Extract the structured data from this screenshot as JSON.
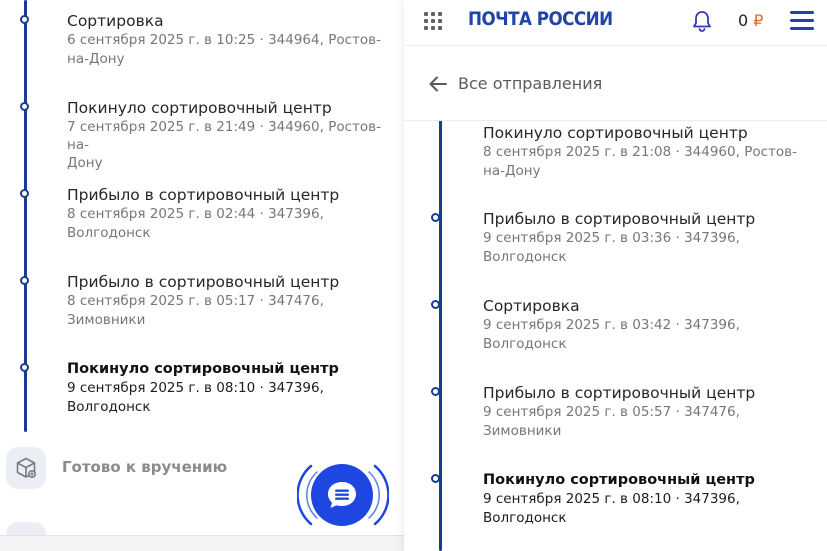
{
  "left_panel": {
    "events": [
      {
        "title": "Сортировка",
        "meta_line1": "6 сентября 2025 г. в 10:25 · 344964, Ростов-",
        "meta_line2": "на-Дону",
        "bold": false
      },
      {
        "title": "Покинуло сортировочный центр",
        "meta_line1": "7 сентября 2025 г. в 21:49 · 344960, Ростов-на-",
        "meta_line2": "Дону",
        "bold": false
      },
      {
        "title": "Прибыло в сортировочный центр",
        "meta_line1": "8 сентября 2025 г. в 02:44 · 347396,",
        "meta_line2": "Волгодонск",
        "bold": false
      },
      {
        "title": "Прибыло в сортировочный центр",
        "meta_line1": "8 сентября 2025 г. в 05:17 · 347476,",
        "meta_line2": "Зимовники",
        "bold": false
      },
      {
        "title": "Покинуло сортировочный центр",
        "meta_line1": "9 сентября 2025 г. в 08:10 · 347396,",
        "meta_line2": "Волгодонск",
        "bold": true
      }
    ],
    "ready_label": "Готово к вручению"
  },
  "right_panel": {
    "header": {
      "logo": "ПОЧТА РОССИИ",
      "points": "0",
      "currency": "₽"
    },
    "back_label": "Все отправления",
    "events": [
      {
        "title": "Покинуло сортировочный центр",
        "meta_line1": "8 сентября 2025 г. в 21:08 · 344960, Ростов-",
        "meta_line2": "на-Дону",
        "bold": false
      },
      {
        "title": "Прибыло в сортировочный центр",
        "meta_line1": "9 сентября 2025 г. в 03:36 · 347396,",
        "meta_line2": "Волгодонск",
        "bold": false
      },
      {
        "title": "Сортировка",
        "meta_line1": "9 сентября 2025 г. в 03:42 · 347396,",
        "meta_line2": "Волгодонск",
        "bold": false
      },
      {
        "title": "Прибыло в сортировочный центр",
        "meta_line1": "9 сентября 2025 г. в 05:57 · 347476,",
        "meta_line2": "Зимовники",
        "bold": false
      },
      {
        "title": "Покинуло сортировочный центр",
        "meta_line1": "9 сентября 2025 г. в 08:10 · 347396,",
        "meta_line2": "Волгодонск",
        "bold": true
      }
    ]
  },
  "colors": {
    "brand_blue": "#2144a8",
    "timeline_blue": "#1b3c8e",
    "chat_blue": "#1d47e0",
    "currency_orange": "#e06a2a"
  },
  "icons": {
    "grid": "grid-icon",
    "bell": "bell-icon",
    "menu": "menu-icon",
    "back": "arrow-left-icon",
    "chat": "chat-icon",
    "parcel": "parcel-box-icon"
  }
}
